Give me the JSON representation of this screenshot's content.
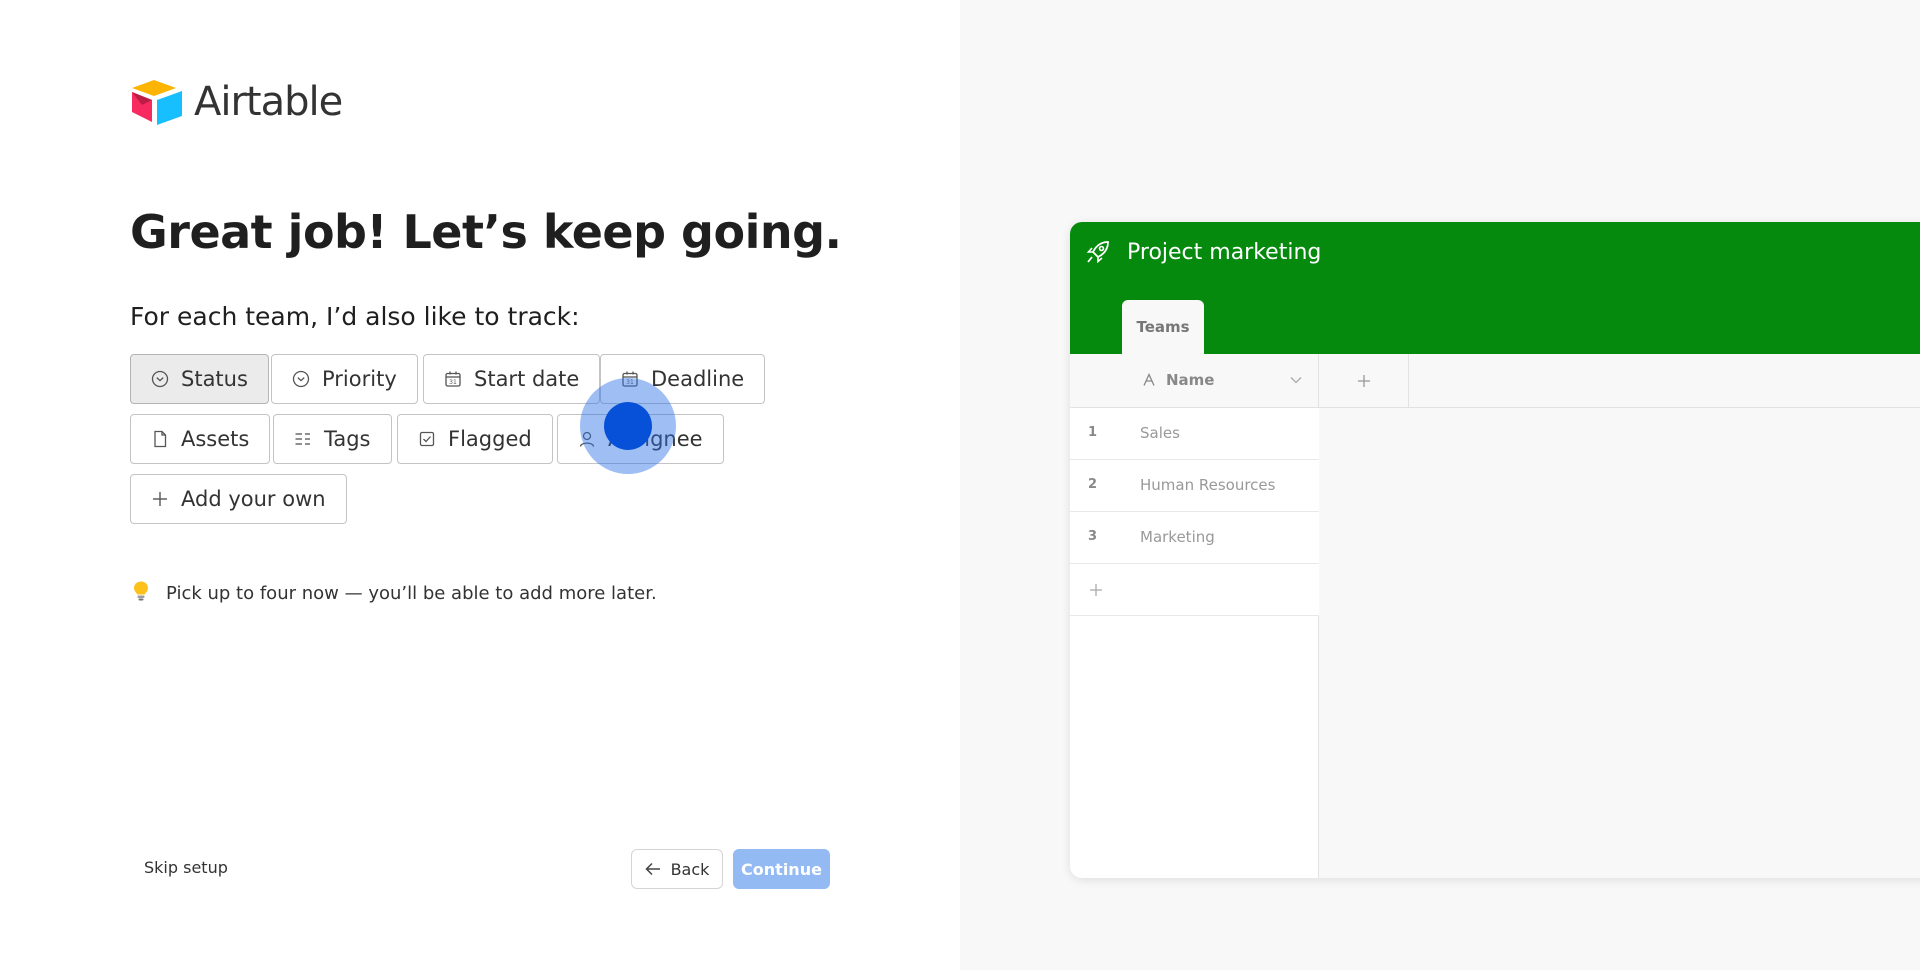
{
  "brand": {
    "name": "Airtable"
  },
  "heading": "Great job! Let’s keep going.",
  "subheading": "For each team, I’d also like to track:",
  "options": [
    {
      "label": "Status",
      "icon": "chevron-circle-icon",
      "selected": true
    },
    {
      "label": "Priority",
      "icon": "chevron-circle-icon",
      "selected": false
    },
    {
      "label": "Start date",
      "icon": "calendar-icon",
      "selected": false
    },
    {
      "label": "Deadline",
      "icon": "calendar-icon",
      "selected": false
    },
    {
      "label": "Assets",
      "icon": "file-icon",
      "selected": false
    },
    {
      "label": "Tags",
      "icon": "tags-list-icon",
      "selected": false
    },
    {
      "label": "Flagged",
      "icon": "checkbox-icon",
      "selected": false
    },
    {
      "label": "Assignee",
      "icon": "user-icon",
      "selected": false
    },
    {
      "label": "Add your own",
      "icon": "plus-icon",
      "selected": false
    }
  ],
  "tip": {
    "icon": "lightbulb-icon",
    "text": "Pick up to four now — you’ll be able to add more later."
  },
  "footer": {
    "skip_label": "Skip setup",
    "back_label": "Back",
    "continue_label": "Continue"
  },
  "preview": {
    "title": "Project marketing",
    "header_color": "#068a0e",
    "tab_label": "Teams",
    "name_column": "Name",
    "rows": [
      {
        "num": "1",
        "name": "Sales"
      },
      {
        "num": "2",
        "name": "Human Resources"
      },
      {
        "num": "3",
        "name": "Marketing"
      }
    ]
  },
  "colors": {
    "continue_disabled": "#93baf3",
    "cursor": "#0750d8"
  }
}
